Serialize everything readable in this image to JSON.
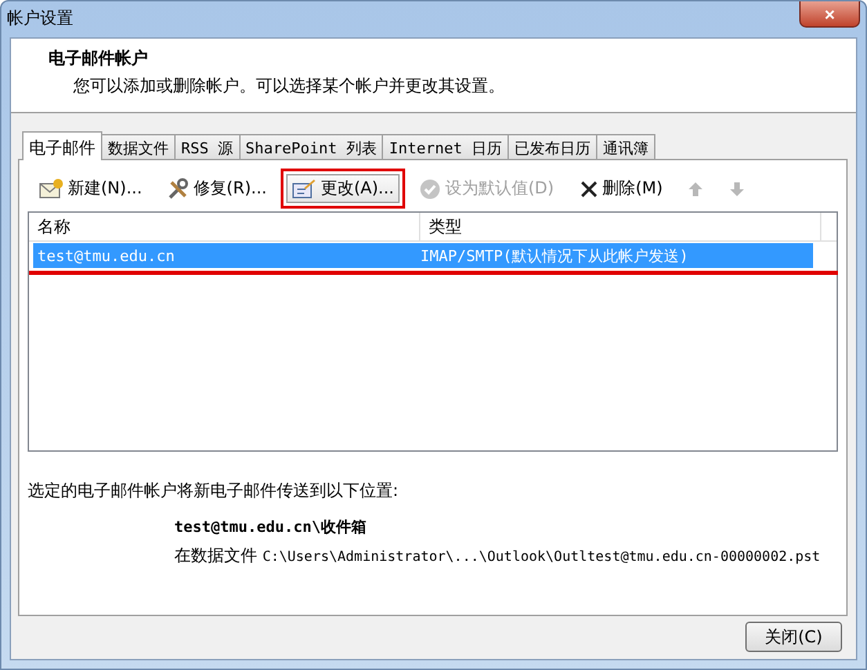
{
  "window": {
    "title": "帐户设置",
    "close_label": "×"
  },
  "header": {
    "title": "电子邮件帐户",
    "description": "您可以添加或删除帐户。可以选择某个帐户并更改其设置。"
  },
  "tabs": [
    {
      "label": "电子邮件",
      "selected": true
    },
    {
      "label": "数据文件",
      "selected": false
    },
    {
      "label": "RSS 源",
      "selected": false
    },
    {
      "label": "SharePoint 列表",
      "selected": false
    },
    {
      "label": "Internet 日历",
      "selected": false
    },
    {
      "label": "已发布日历",
      "selected": false
    },
    {
      "label": "通讯簿",
      "selected": false
    }
  ],
  "toolbar": [
    {
      "kind": "new",
      "label": "新建(N)...",
      "disabled": false,
      "highlighted": false
    },
    {
      "kind": "repair",
      "label": "修复(R)...",
      "disabled": false,
      "highlighted": false
    },
    {
      "kind": "change",
      "label": "更改(A)...",
      "disabled": false,
      "highlighted": true
    },
    {
      "kind": "default",
      "label": "设为默认值(D)",
      "disabled": true,
      "highlighted": false
    },
    {
      "kind": "delete",
      "label": "删除(M)",
      "disabled": false,
      "highlighted": false
    },
    {
      "kind": "up",
      "disabled": true,
      "highlighted": false
    },
    {
      "kind": "down",
      "disabled": true,
      "highlighted": false
    }
  ],
  "table": {
    "columns": [
      "名称",
      "类型"
    ],
    "rows": [
      {
        "cells": [
          "test@tmu.edu.cn",
          "IMAP/SMTP(默认情况下从此帐户发送)"
        ],
        "selected": true,
        "underlined": true
      }
    ]
  },
  "delivery": {
    "caption": "选定的电子邮件帐户将新电子邮件传送到以下位置:",
    "folder": "test@tmu.edu.cn\\收件箱",
    "prefix": "在数据文件",
    "path": "C:\\Users\\Administrator\\...\\Outlook\\Outltest@tmu.edu.cn-00000002.pst"
  },
  "buttons": [
    "关闭(C)"
  ]
}
